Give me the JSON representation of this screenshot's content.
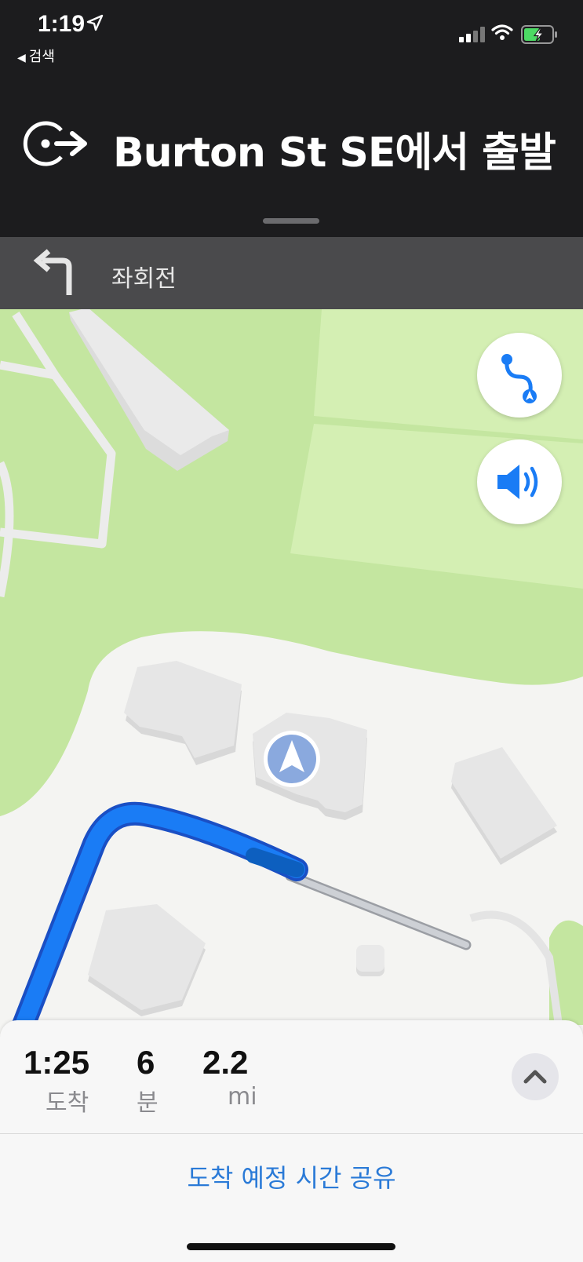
{
  "status_bar": {
    "time": "1:19",
    "back_label": "검색",
    "location_icon": "location-arrow-icon",
    "signal_icon": "cellular-signal-icon",
    "wifi_icon": "wifi-icon",
    "battery_icon": "battery-charging-icon",
    "battery_color": "#4cd964"
  },
  "navigation": {
    "instruction": "Burton St SE에서 출발",
    "instruction_icon": "depart-arrow-icon",
    "next_maneuver": "좌회전",
    "next_maneuver_icon": "turn-left-icon"
  },
  "map": {
    "overview_button_icon": "route-overview-icon",
    "audio_button_icon": "speaker-volume-icon",
    "route_color": "#1a7cf5",
    "location_puck_icon": "navigation-arrow-icon"
  },
  "trip": {
    "arrival_time": "1:25",
    "arrival_label": "도착",
    "minutes": "6",
    "minutes_label": "분",
    "distance": "2.2",
    "distance_label": "mi",
    "expand_icon": "chevron-up-icon",
    "share_eta_label": "도착 예정 시간 공유",
    "accent_color": "#2a7ad7"
  }
}
